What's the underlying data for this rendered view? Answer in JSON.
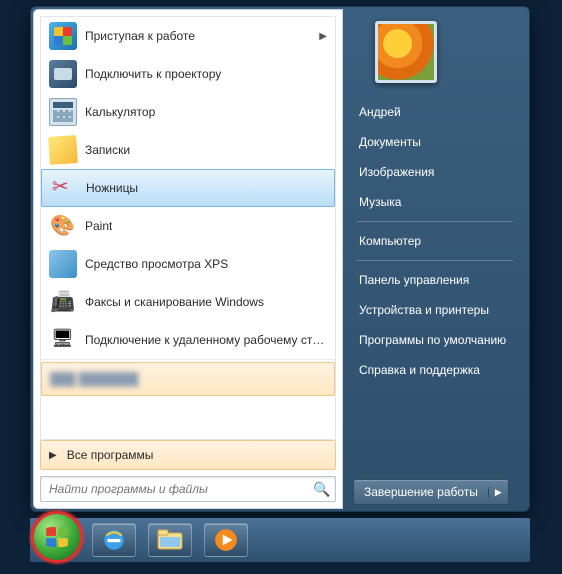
{
  "programs": [
    {
      "label": "Приступая к работе",
      "icon": "flag-icon",
      "has_submenu": true
    },
    {
      "label": "Подключить к проектору",
      "icon": "projector-icon",
      "has_submenu": false
    },
    {
      "label": "Калькулятор",
      "icon": "calculator-icon",
      "has_submenu": false
    },
    {
      "label": "Записки",
      "icon": "sticky-notes-icon",
      "has_submenu": false
    },
    {
      "label": "Ножницы",
      "icon": "snipping-tool-icon",
      "has_submenu": false,
      "hovered": true
    },
    {
      "label": "Paint",
      "icon": "paint-icon",
      "has_submenu": false
    },
    {
      "label": "Средство просмотра XPS",
      "icon": "xps-viewer-icon",
      "has_submenu": false
    },
    {
      "label": "Факсы и сканирование Windows",
      "icon": "fax-scan-icon",
      "has_submenu": false
    },
    {
      "label": "Подключение к удаленному рабочему столу",
      "icon": "remote-desktop-icon",
      "has_submenu": false
    }
  ],
  "all_programs_label": "Все программы",
  "search": {
    "placeholder": "Найти программы и файлы"
  },
  "user": {
    "name": "Андрей"
  },
  "right_items_1": [
    "Документы",
    "Изображения",
    "Музыка"
  ],
  "right_items_2": [
    "Компьютер"
  ],
  "right_items_3": [
    "Панель управления",
    "Устройства и принтеры",
    "Программы по умолчанию",
    "Справка и поддержка"
  ],
  "shutdown": {
    "label": "Завершение работы"
  },
  "taskbar": {
    "items": [
      "ie-icon",
      "explorer-icon",
      "media-player-icon"
    ]
  }
}
